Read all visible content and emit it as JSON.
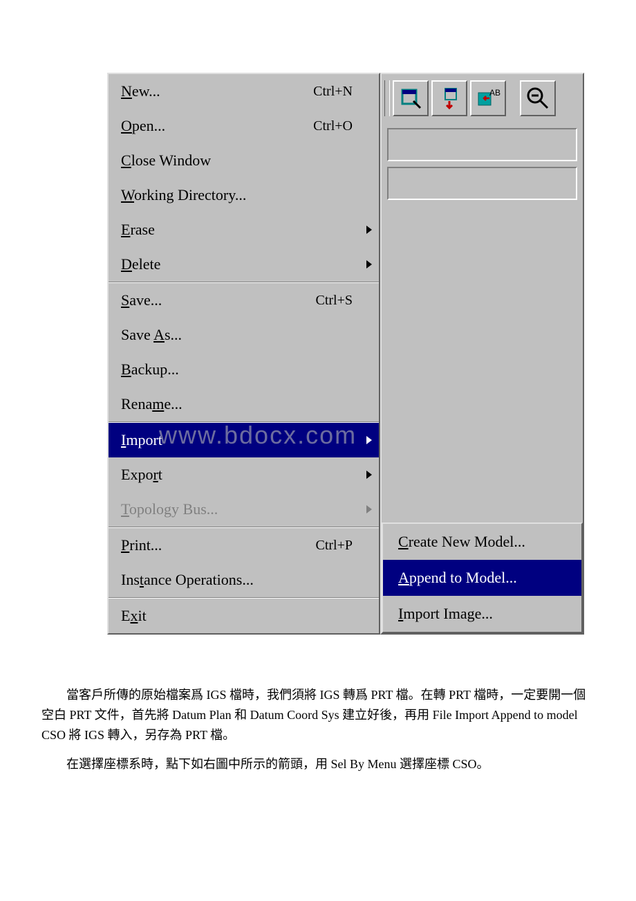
{
  "menu": {
    "sections": [
      [
        {
          "pre": "",
          "u": "N",
          "post": "ew...",
          "shortcut": "Ctrl+N",
          "sub": false
        },
        {
          "pre": "",
          "u": "O",
          "post": "pen...",
          "shortcut": "Ctrl+O",
          "sub": false
        },
        {
          "pre": "",
          "u": "C",
          "post": "lose Window",
          "shortcut": "",
          "sub": false
        },
        {
          "pre": "",
          "u": "W",
          "post": "orking Directory...",
          "shortcut": "",
          "sub": false
        },
        {
          "pre": "",
          "u": "E",
          "post": "rase",
          "shortcut": "",
          "sub": true
        },
        {
          "pre": "",
          "u": "D",
          "post": "elete",
          "shortcut": "",
          "sub": true
        }
      ],
      [
        {
          "pre": "",
          "u": "S",
          "post": "ave...",
          "shortcut": "Ctrl+S",
          "sub": false
        },
        {
          "pre": "Save ",
          "u": "A",
          "post": "s...",
          "shortcut": "",
          "sub": false
        },
        {
          "pre": "",
          "u": "B",
          "post": "ackup...",
          "shortcut": "",
          "sub": false
        },
        {
          "pre": "Rena",
          "u": "m",
          "post": "e...",
          "shortcut": "",
          "sub": false
        }
      ],
      [
        {
          "pre": "",
          "u": "I",
          "post": "mport",
          "shortcut": "",
          "sub": true,
          "highlighted": true
        },
        {
          "pre": "Expo",
          "u": "r",
          "post": "t",
          "shortcut": "",
          "sub": true
        },
        {
          "pre": "",
          "u": "T",
          "post": "opology Bus...",
          "shortcut": "",
          "sub": true,
          "disabled": true
        }
      ],
      [
        {
          "pre": "",
          "u": "P",
          "post": "rint...",
          "shortcut": "Ctrl+P",
          "sub": false
        },
        {
          "pre": "Ins",
          "u": "t",
          "post": "ance Operations...",
          "shortcut": "",
          "sub": false
        }
      ],
      [
        {
          "pre": "E",
          "u": "x",
          "post": "it",
          "shortcut": "",
          "sub": false
        }
      ]
    ]
  },
  "submenu": {
    "items": [
      {
        "pre": "",
        "u": "C",
        "post": "reate New Model..."
      },
      {
        "pre": "",
        "u": "A",
        "post": "ppend to Model...",
        "highlighted": true
      },
      {
        "pre": "",
        "u": "I",
        "post": "mport Image..."
      }
    ]
  },
  "watermark": "www.bdocx.com",
  "bodyText": {
    "p1": "當客戶所傳的原始檔案爲 IGS 檔時，我們須將 IGS 轉爲 PRT 檔。在轉 PRT 檔時，一定要開一個空白 PRT 文件，首先將 Datum Plan 和 Datum Coord Sys 建立好後，再用 File  Import  Append  to model  CSO 將 IGS 轉入，另存為 PRT 檔。",
    "p2": "在選擇座標系時，點下如右圖中所示的箭頭，用 Sel By Menu 選擇座標 CSO。"
  }
}
